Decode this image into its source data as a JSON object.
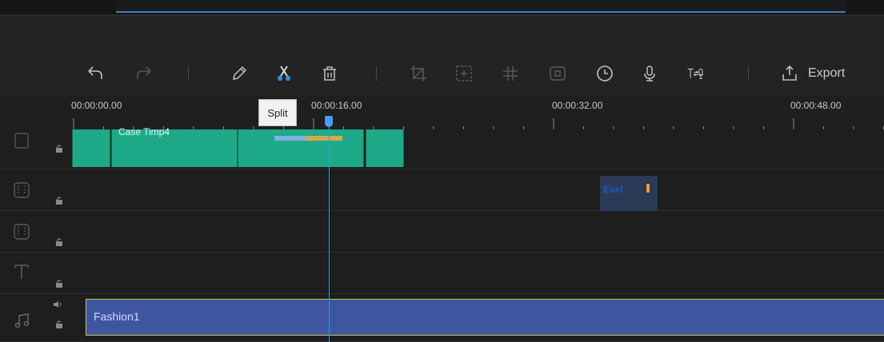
{
  "toolbar": {
    "tools": [
      {
        "name": "undo-icon"
      },
      {
        "name": "redo-icon"
      },
      {
        "name": "pencil-icon"
      },
      {
        "name": "scissors-icon"
      },
      {
        "name": "trash-icon"
      },
      {
        "name": "crop-icon"
      },
      {
        "name": "zoom-icon"
      },
      {
        "name": "mosaic-icon"
      },
      {
        "name": "screenshot-icon"
      },
      {
        "name": "clock-icon"
      },
      {
        "name": "mic-icon"
      },
      {
        "name": "text-to-speech-icon"
      },
      {
        "name": "export-icon"
      }
    ],
    "export_label": "Export",
    "accent": "#3b7fc4"
  },
  "tooltip": {
    "text": "Split"
  },
  "ruler": {
    "labels": [
      "00:00:00.00",
      "00:00:16.00",
      "00:00:32.00",
      "00:00:48.00"
    ]
  },
  "tracks": {
    "video_clip_label": "Case Timp4",
    "title_clip_text": "Exel",
    "audio_clip_label": "Fashion1",
    "clip_color": "#1ea988",
    "audio_color": "#3e56a0"
  },
  "playhead": {
    "color": "#2a9ce6"
  }
}
